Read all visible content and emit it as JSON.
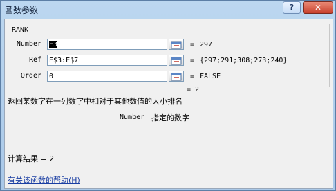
{
  "window": {
    "title": "函数参数",
    "help_label": "?",
    "close_label": "✕"
  },
  "function_name": "RANK",
  "args": [
    {
      "label": "Number",
      "value": "E3",
      "result": "297"
    },
    {
      "label": "Ref",
      "value": "E$3:E$7",
      "result": "{297;291;308;273;240}"
    },
    {
      "label": "Order",
      "value": "0",
      "result": "FALSE"
    }
  ],
  "equals_sign": "=",
  "function_result": "= 2",
  "description": "返回某数字在一列数字中相对于其他数值的大小排名",
  "arg_help": {
    "name": "Number",
    "text": "指定的数字"
  },
  "calc_result": "计算结果 =  2",
  "help_link": "有关该函数的帮助(H)"
}
